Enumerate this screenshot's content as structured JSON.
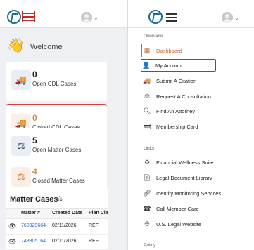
{
  "left": {
    "welcome": "Welcome",
    "cards": [
      {
        "value": "0",
        "label": "Open CDL Cases",
        "icon": "truck-icon"
      },
      {
        "value": "0",
        "label": "Closed CDL Cases",
        "icon": "truck-icon"
      },
      {
        "value": "5",
        "label": "Open Matter Cases",
        "icon": "scale-icon"
      },
      {
        "value": "4",
        "label": "Closed Matter Cases",
        "icon": "scale-icon"
      }
    ],
    "table": {
      "title": "Matter Cases",
      "columns": [
        "Matter #",
        "Created Date",
        "Plan Cla"
      ],
      "rows": [
        {
          "matter": "760929664",
          "date": "02/11/2026",
          "plan": "REF"
        },
        {
          "matter": "743305164",
          "date": "02/11/2026",
          "plan": "REF"
        }
      ]
    }
  },
  "menu": {
    "overview_title": "Overview",
    "overview": [
      {
        "label": "Dashboard",
        "icon": "dashboard-icon"
      },
      {
        "label": "My Account",
        "icon": "user-icon"
      },
      {
        "label": "Submit A Citation",
        "icon": "truck-icon"
      },
      {
        "label": "Request A Consultation",
        "icon": "scale-icon"
      },
      {
        "label": "Find An Attorney",
        "icon": "search-icon"
      },
      {
        "label": "Membership Card",
        "icon": "id-card-icon"
      }
    ],
    "links_title": "Links",
    "links": [
      {
        "label": "Financial Wellness Suite",
        "icon": "gear-icon"
      },
      {
        "label": "Legal Document Library",
        "icon": "document-icon"
      },
      {
        "label": "Identity Monitoring Services",
        "icon": "link-icon"
      },
      {
        "label": "Call Member Care",
        "icon": "phone-icon"
      },
      {
        "label": "U.S. Legal Website",
        "icon": "globe-icon"
      }
    ],
    "policy_title": "Policy"
  },
  "colors": {
    "accent": "#c46a3c",
    "highlight": "#c62828",
    "link": "#2464c8"
  }
}
